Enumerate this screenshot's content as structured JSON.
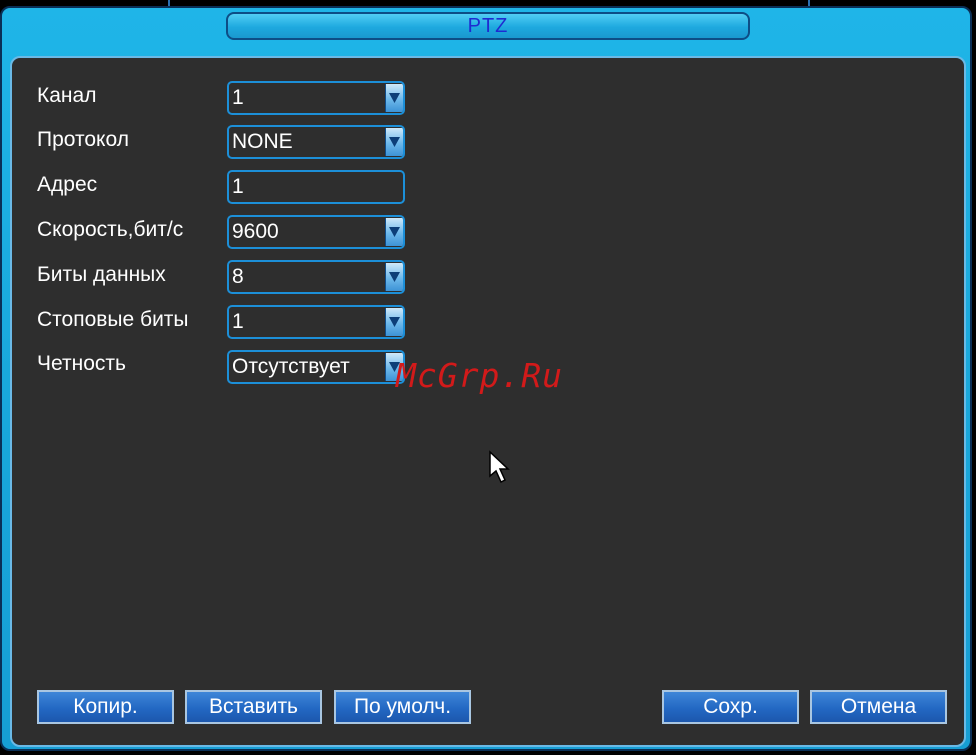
{
  "window": {
    "title": "PTZ"
  },
  "form": {
    "fields": [
      {
        "label": "Канал",
        "value": "1",
        "type": "dropdown"
      },
      {
        "label": "Протокол",
        "value": "NONE",
        "type": "dropdown"
      },
      {
        "label": "Адрес",
        "value": "1",
        "type": "text"
      },
      {
        "label": "Скорость,бит/с",
        "value": "9600",
        "type": "dropdown"
      },
      {
        "label": "Биты данных",
        "value": "8",
        "type": "dropdown"
      },
      {
        "label": "Стоповые биты",
        "value": "1",
        "type": "dropdown"
      },
      {
        "label": "Четность",
        "value": "Отсутствует",
        "type": "dropdown"
      }
    ]
  },
  "buttons": {
    "copy": "Копир.",
    "paste": "Вставить",
    "default": "По умолч.",
    "save": "Сохр.",
    "cancel": "Отмена"
  },
  "watermark": "McGrp.Ru",
  "icons": {
    "dropdown": "chevron-down-icon",
    "cursor": "mouse-pointer-icon"
  },
  "colors": {
    "frame": "#19a8dc",
    "panel": "#2e2e2e",
    "field_border": "#1c8fd8",
    "title_text": "#1f2bd1",
    "button": "#2368c3",
    "watermark": "#d21a1a"
  }
}
